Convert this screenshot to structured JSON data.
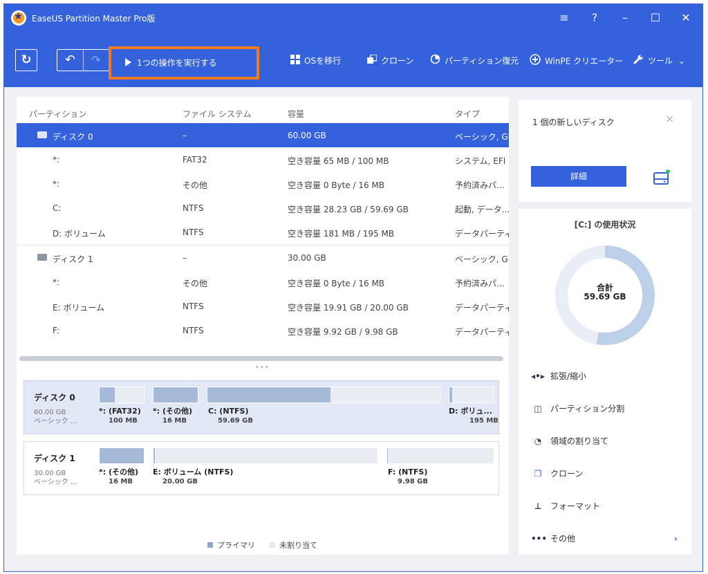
{
  "window": {
    "title": "EaseUS Partition Master Pro版"
  },
  "title_controls": {
    "menu": "≡",
    "help": "?",
    "minimize": "–",
    "maximize": "☐",
    "close": "✕"
  },
  "toolbar": {
    "execute_label": "1つの操作を実行する",
    "migrate_os": "OSを移行",
    "clone": "クローン",
    "partition_recovery": "パーティション復元",
    "winpe": "WinPE クリエーター",
    "tools": "ツール"
  },
  "table": {
    "headers": {
      "partition": "パーティション",
      "filesystem": "ファイル システム",
      "capacity": "容量",
      "type": "タイプ"
    },
    "rows": [
      {
        "name": "ディスク 0",
        "fs": "–",
        "cap": "60.00 GB",
        "type": "ベーシック, GP"
      },
      {
        "name": "*:",
        "fs": "FAT32",
        "cap": "空き容量 65 MB / 100 MB",
        "type": "システム, EFI"
      },
      {
        "name": "*:",
        "fs": "その他",
        "cap": "空き容量 0 Byte / 16 MB",
        "type": "予約済みパ..."
      },
      {
        "name": "C:",
        "fs": "NTFS",
        "cap": "空き容量 28.23 GB / 59.69 GB",
        "type": "起動, データ..."
      },
      {
        "name": "D: ボリューム",
        "fs": "NTFS",
        "cap": "空き容量 181 MB / 195 MB",
        "type": "データパーティ"
      },
      {
        "name": "ディスク 1",
        "fs": "–",
        "cap": "30.00 GB",
        "type": "ベーシック, GP"
      },
      {
        "name": "*:",
        "fs": "その他",
        "cap": "空き容量 0 Byte / 16 MB",
        "type": "予約済みパ..."
      },
      {
        "name": "E: ボリューム",
        "fs": "NTFS",
        "cap": "空き容量 19.91 GB / 20.00 GB",
        "type": "データパーティ"
      },
      {
        "name": "F:",
        "fs": "NTFS",
        "cap": "空き容量 9.92 GB / 9.98 GB",
        "type": "データパーティ"
      }
    ]
  },
  "diskmap": {
    "disk0": {
      "name": "ディスク 0",
      "size": "60.00 GB",
      "kind": "ベーシック ...",
      "parts": [
        {
          "label": "*: (FAT32)",
          "size": "100 MB",
          "used": 0.35
        },
        {
          "label": "*: (その他)",
          "size": "16 MB",
          "used": 1.0
        },
        {
          "label": "C: (NTFS)",
          "size": "59.69 GB",
          "used": 0.53
        },
        {
          "label": "D: ボリュ...",
          "size": "195 MB",
          "used": 0.07
        }
      ]
    },
    "disk1": {
      "name": "ディスク 1",
      "size": "30.00 GB",
      "kind": "ベーシック ...",
      "parts": [
        {
          "label": "*: (その他)",
          "size": "16 MB",
          "used": 1.0
        },
        {
          "label": "E: ボリューム (NTFS)",
          "size": "20.00 GB",
          "used": 0.005
        },
        {
          "label": "F: (NTFS)",
          "size": "9.98 GB",
          "used": 0.006
        }
      ]
    }
  },
  "legend": {
    "primary": "プライマリ",
    "unallocated": "未割り当て"
  },
  "notice": {
    "text": "1 個の新しいディスク",
    "details_button": "詳細"
  },
  "usage": {
    "title": "[C:] の使用状況",
    "total_label": "合計",
    "total_value": "59.69 GB"
  },
  "actions": [
    {
      "icon": "◂•▸",
      "label": "拡張/縮小"
    },
    {
      "icon": "◫",
      "label": "パーティション分割"
    },
    {
      "icon": "◔",
      "label": "領域の割り当て"
    },
    {
      "icon": "❐",
      "label": "クローン"
    },
    {
      "icon": "⊥",
      "label": "フォーマット"
    },
    {
      "icon": "•••",
      "label": "その他"
    }
  ],
  "colors": {
    "accent": "#3461dc",
    "highlight": "#f47b20",
    "partition_fill": "#a6b9d8",
    "donut": "#bdd0ea"
  }
}
